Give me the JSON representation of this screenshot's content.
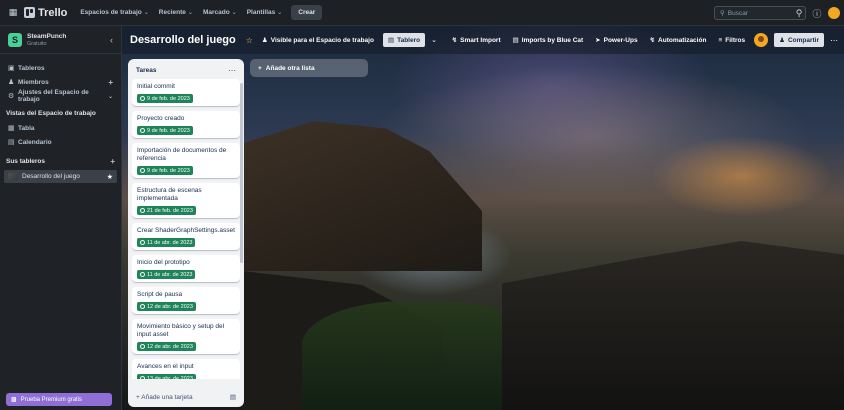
{
  "topbar": {
    "app_name": "Trello",
    "menus": [
      {
        "label": "Espacios de trabajo"
      },
      {
        "label": "Reciente"
      },
      {
        "label": "Marcado"
      },
      {
        "label": "Plantillas"
      }
    ],
    "create_label": "Crear",
    "search_placeholder": "Buscar"
  },
  "sidebar": {
    "workspace_initial": "S",
    "workspace_name": "SteamPunch",
    "workspace_plan": "Gratuito",
    "items": [
      {
        "label": "Tableros",
        "icon": "board-icon"
      },
      {
        "label": "Miembros",
        "icon": "members-icon"
      },
      {
        "label": "Ajustes del Espacio de trabajo",
        "icon": "gear-icon"
      }
    ],
    "views_heading": "Vistas del Espacio de trabajo",
    "views": [
      {
        "label": "Tabla",
        "icon": "table-icon"
      },
      {
        "label": "Calendario",
        "icon": "calendar-icon"
      }
    ],
    "boards_heading": "Sus tableros",
    "boards": [
      {
        "label": "Desarrollo del juego"
      }
    ],
    "premium_label": "Prueba Premium gratis"
  },
  "board": {
    "title": "Desarrollo del juego",
    "visibility_label": "Visible para el Espacio de trabajo",
    "view_label": "Tablero",
    "actions": [
      {
        "label": "Smart Import"
      },
      {
        "label": "Imports by Blue Cat"
      },
      {
        "label": "Power-Ups"
      },
      {
        "label": "Automatización"
      },
      {
        "label": "Filtros"
      }
    ],
    "share_label": "Compartir",
    "add_list_label": "Añade otra lista"
  },
  "list": {
    "title": "Tareas",
    "add_card_label": "Añade una tarjeta",
    "cards": [
      {
        "title": "Initial commit",
        "due": "9 de feb. de 2023"
      },
      {
        "title": "Proyecto creado",
        "due": "9 de feb. de 2023"
      },
      {
        "title": "Importación de documentos de referencia",
        "due": "9 de feb. de 2023"
      },
      {
        "title": "Estructura de escenas implementada",
        "due": "21 de feb. de 2023"
      },
      {
        "title": "Crear ShaderGraphSettings.asset",
        "due": "11 de abr. de 2023"
      },
      {
        "title": "Inicio del prototipo",
        "due": "11 de abr. de 2023"
      },
      {
        "title": "Script de pausa",
        "due": "12 de abr. de 2023"
      },
      {
        "title": "Movimiento básico y setup del input asset",
        "due": "12 de abr. de 2023"
      },
      {
        "title": "Avances en el input",
        "due": "13 de abr. de 2023"
      }
    ]
  },
  "colors": {
    "due_badge": "#1f845a",
    "workspace_logo": "#4bce97",
    "premium": "#8f6ed5"
  }
}
